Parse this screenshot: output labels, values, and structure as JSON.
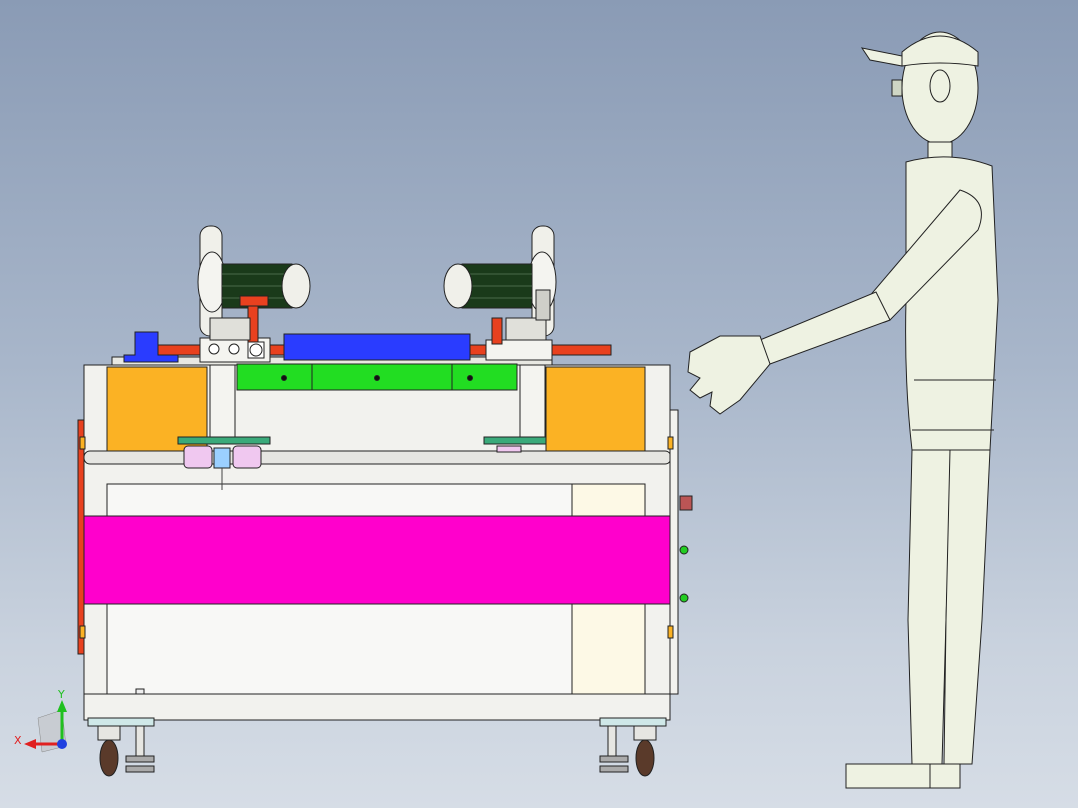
{
  "viewport": {
    "background_top": "#8a9bb5",
    "background_bottom": "#d6dde6"
  },
  "colors": {
    "frame": "#f2f2ee",
    "frame_stroke": "#222222",
    "orange_panel": "#fbb224",
    "magenta_panel": "#ff00cc",
    "green_rail": "#22dd22",
    "blue_block": "#2a3cff",
    "red_bar": "#e8411f",
    "motor_body": "#f0f0ea",
    "motor_fins": "#1a3a1a",
    "cream_panel": "#fdf9e6",
    "mannequin": "#eef2e2",
    "caster_wheel": "#5a3a2a"
  },
  "triad": {
    "x_label": "X",
    "y_label": "Y",
    "x_color": "#e02020",
    "y_color": "#20c020",
    "z_color": "#2040e0"
  },
  "icons": [
    "axis-triad-icon"
  ]
}
